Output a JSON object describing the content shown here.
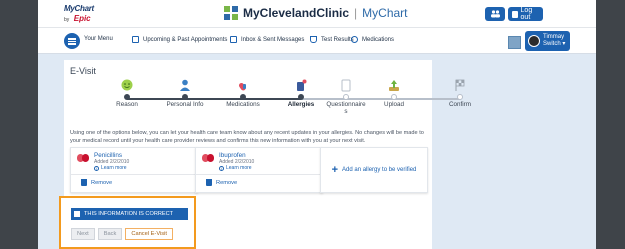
{
  "header": {
    "logo_mychart": "MyChart",
    "logo_by": "by",
    "logo_epic": "Epic",
    "brand_name": "MyClevelandClinic",
    "brand_sep": "|",
    "brand_app": "MyChart",
    "logout_label": "Log out"
  },
  "nav": {
    "menu_label": "Your Menu",
    "items": [
      {
        "label": "Upcoming & Past Appointments",
        "icon": "calendar-icon"
      },
      {
        "label": "Inbox & Sent Messages",
        "icon": "envelope-icon"
      },
      {
        "label": "Test Results",
        "icon": "flask-icon"
      },
      {
        "label": "Medications",
        "icon": "pill-bottle-icon"
      }
    ],
    "switch_name": "Timmay",
    "switch_label": "Switch"
  },
  "page": {
    "title": "E-Visit",
    "steps": [
      {
        "label": "Reason",
        "done": true
      },
      {
        "label": "Personal Info",
        "done": true
      },
      {
        "label": "Medications",
        "done": true
      },
      {
        "label": "Allergies",
        "done": true,
        "active": true
      },
      {
        "label": "Questionnaire\ns",
        "done": false
      },
      {
        "label": "Upload",
        "done": false
      },
      {
        "label": "Confirm",
        "done": false
      }
    ],
    "info_text": "Using one of the options below, you can let your health care team know about any recent updates in your allergies. No changes will be made to your medical record until your health care provider reviews and confirms this new information with you at your next visit.",
    "allergies": [
      {
        "name": "Penicillins",
        "added": "Added 2/2/2010",
        "learn": "Learn more",
        "remove": "Remove"
      },
      {
        "name": "Ibuprofen",
        "added": "Added 2/2/2010",
        "learn": "Learn more",
        "remove": "Remove"
      }
    ],
    "add_label": "Add an allergy to be verified",
    "confirm_label": "THIS INFORMATION IS CORRECT",
    "buttons": {
      "next": "Next",
      "back": "Back",
      "cancel": "Cancel E-Visit"
    }
  },
  "colors": {
    "accent": "#1d62b0",
    "highlight_border": "#f39a1e",
    "page_bg": "#dfe9f4"
  }
}
